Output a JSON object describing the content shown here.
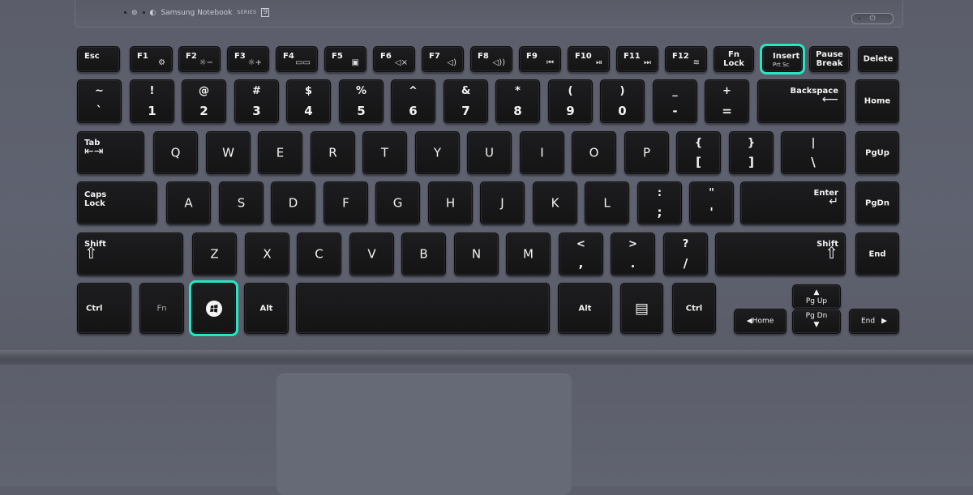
{
  "device": {
    "brand_text": "Samsung Notebook",
    "series_text": "SERIES",
    "series_number": "9",
    "indicators": [
      "wireless-indicator-icon",
      "battery-indicator-icon"
    ],
    "power_button_icon": "power-icon",
    "highlight_color": "#27e6c4"
  },
  "highlighted_keys": [
    "Insert",
    "Windows"
  ],
  "rows": {
    "function": [
      {
        "label": "Esc"
      },
      {
        "label": "F1",
        "icon": "settings-icon",
        "glyph": "⚙"
      },
      {
        "label": "F2",
        "icon": "brightness-down-icon",
        "glyph": "☼−"
      },
      {
        "label": "F3",
        "icon": "brightness-up-icon",
        "glyph": "☼+"
      },
      {
        "label": "F4",
        "icon": "display-switch-icon",
        "glyph": "▭▭"
      },
      {
        "label": "F5",
        "icon": "touchpad-toggle-icon",
        "glyph": "▣"
      },
      {
        "label": "F6",
        "icon": "mute-icon",
        "glyph": "◁×"
      },
      {
        "label": "F7",
        "icon": "volume-down-icon",
        "glyph": "◁)"
      },
      {
        "label": "F8",
        "icon": "volume-up-icon",
        "glyph": "◁))"
      },
      {
        "label": "F9",
        "icon": "previous-track-icon",
        "glyph": "⏮"
      },
      {
        "label": "F10",
        "icon": "play-pause-icon",
        "glyph": "⏯"
      },
      {
        "label": "F11",
        "icon": "next-track-icon",
        "glyph": "⏭"
      },
      {
        "label": "F12",
        "icon": "wireless-icon",
        "glyph": "≋"
      },
      {
        "label": "Fn",
        "label2": "Lock"
      },
      {
        "label": "Insert",
        "sub": "Prt Sc"
      },
      {
        "label": "Pause",
        "label2": "Break"
      },
      {
        "label": "Delete"
      }
    ],
    "number": [
      {
        "top": "~",
        "bottom": "`"
      },
      {
        "top": "!",
        "bottom": "1"
      },
      {
        "top": "@",
        "bottom": "2"
      },
      {
        "top": "#",
        "bottom": "3"
      },
      {
        "top": "$",
        "bottom": "4"
      },
      {
        "top": "%",
        "bottom": "5"
      },
      {
        "top": "^",
        "bottom": "6"
      },
      {
        "top": "&",
        "bottom": "7"
      },
      {
        "top": "*",
        "bottom": "8"
      },
      {
        "top": "(",
        "bottom": "9"
      },
      {
        "top": ")",
        "bottom": "0"
      },
      {
        "top": "_",
        "bottom": "-"
      },
      {
        "top": "+",
        "bottom": "="
      },
      {
        "label": "Backspace",
        "glyph": "⟵"
      },
      {
        "label": "Home"
      }
    ],
    "qwerty": [
      {
        "label": "Tab",
        "glyph": "⇤⇥"
      },
      {
        "label": "Q"
      },
      {
        "label": "W"
      },
      {
        "label": "E"
      },
      {
        "label": "R"
      },
      {
        "label": "T"
      },
      {
        "label": "Y"
      },
      {
        "label": "U"
      },
      {
        "label": "I"
      },
      {
        "label": "O"
      },
      {
        "label": "P"
      },
      {
        "top": "{",
        "bottom": "["
      },
      {
        "top": "}",
        "bottom": "]"
      },
      {
        "top": "|",
        "bottom": "\\"
      },
      {
        "label": "PgUp"
      }
    ],
    "home": [
      {
        "label": "Caps",
        "label2": "Lock"
      },
      {
        "label": "A"
      },
      {
        "label": "S"
      },
      {
        "label": "D"
      },
      {
        "label": "F"
      },
      {
        "label": "G"
      },
      {
        "label": "H"
      },
      {
        "label": "J"
      },
      {
        "label": "K"
      },
      {
        "label": "L"
      },
      {
        "top": ":",
        "bottom": ";"
      },
      {
        "top": "\"",
        "bottom": "'"
      },
      {
        "label": "Enter",
        "glyph": "↵"
      },
      {
        "label": "PgDn"
      }
    ],
    "shift": [
      {
        "label": "Shift",
        "glyph": "⇧"
      },
      {
        "label": "Z"
      },
      {
        "label": "X"
      },
      {
        "label": "C"
      },
      {
        "label": "V"
      },
      {
        "label": "B"
      },
      {
        "label": "N"
      },
      {
        "label": "M"
      },
      {
        "top": "<",
        "bottom": ","
      },
      {
        "top": ">",
        "bottom": "."
      },
      {
        "top": "?",
        "bottom": "/"
      },
      {
        "label": "Shift",
        "glyph": "⇧"
      },
      {
        "label": "End"
      }
    ],
    "bottom": [
      {
        "label": "Ctrl"
      },
      {
        "label": "Fn"
      },
      {
        "label": "",
        "icon": "windows-logo-icon"
      },
      {
        "label": "Alt"
      },
      {
        "label": ""
      },
      {
        "label": "Alt"
      },
      {
        "label": "",
        "icon": "menu-icon",
        "glyph": "▤"
      },
      {
        "label": "Ctrl"
      },
      {
        "label": "Home",
        "glyph": "◀"
      },
      {
        "label": "Pg Up",
        "glyph": "▲"
      },
      {
        "label": "Pg Dn",
        "glyph": "▼"
      },
      {
        "label": "End",
        "glyph": "▶"
      }
    ]
  }
}
